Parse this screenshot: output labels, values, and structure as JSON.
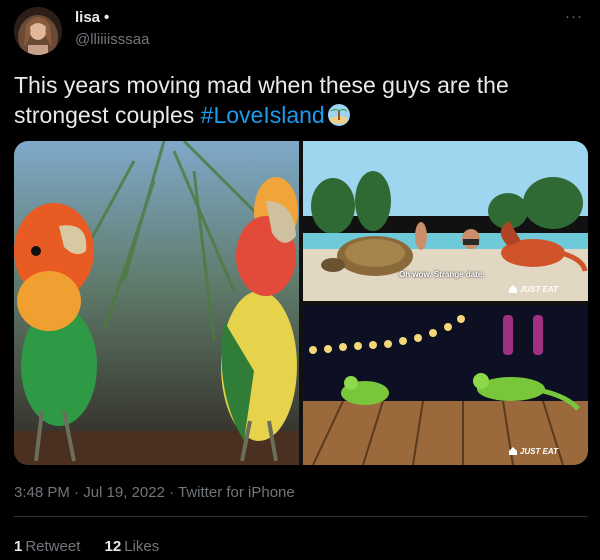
{
  "author": {
    "display_name": "lisa",
    "dot": "•",
    "handle": "@lliiiisssaa"
  },
  "more_label": "···",
  "tweet": {
    "text": "This years moving mad when these guys are the strongest couples ",
    "hashtag": "#LoveIsland",
    "emoji_icon": "desert-island-emoji"
  },
  "media": [
    {
      "name": "parrots-photo"
    },
    {
      "name": "turtle-lizard-beach-photo",
      "caption": "Oh wow. Strange date.",
      "brand": "JUST EAT"
    },
    {
      "name": "geckos-deck-photo",
      "brand": "JUST EAT"
    }
  ],
  "meta": {
    "time": "3:48 PM",
    "sep1": " · ",
    "date": "Jul 19, 2022",
    "sep2": " · ",
    "source": "Twitter for iPhone"
  },
  "stats": {
    "retweets_count": "1",
    "retweets_label": "Retweet",
    "likes_count": "12",
    "likes_label": "Likes"
  },
  "colors": {
    "background": "#000000",
    "text": "#e7e9ea",
    "secondary": "#71767b",
    "link": "#1d9bf0"
  }
}
